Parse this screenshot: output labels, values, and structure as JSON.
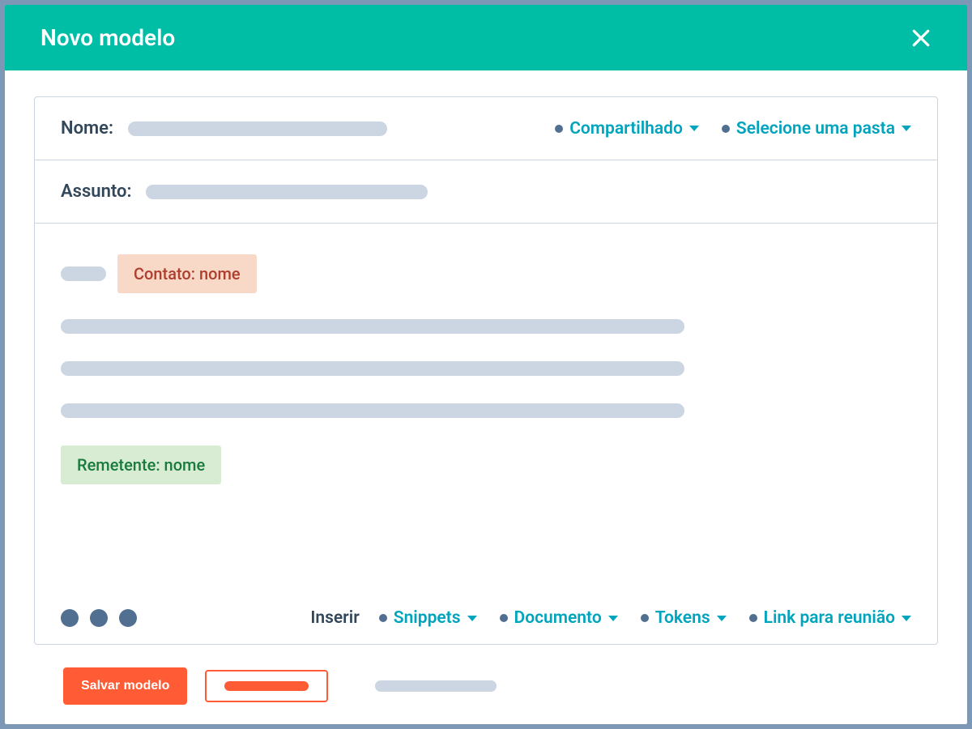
{
  "header": {
    "title": "Novo modelo"
  },
  "fields": {
    "name_label": "Nome:",
    "subject_label": "Assunto:"
  },
  "dropdowns": {
    "shared": "Compartilhado",
    "folder": "Selecione uma pasta"
  },
  "tokens": {
    "contact_name": "Contato: nome",
    "sender_name": "Remetente: nome"
  },
  "toolbar": {
    "insert_label": "Inserir",
    "snippets": "Snippets",
    "document": "Documento",
    "tokens": "Tokens",
    "meeting_link": "Link para reunião"
  },
  "footer": {
    "save": "Salvar modelo"
  }
}
